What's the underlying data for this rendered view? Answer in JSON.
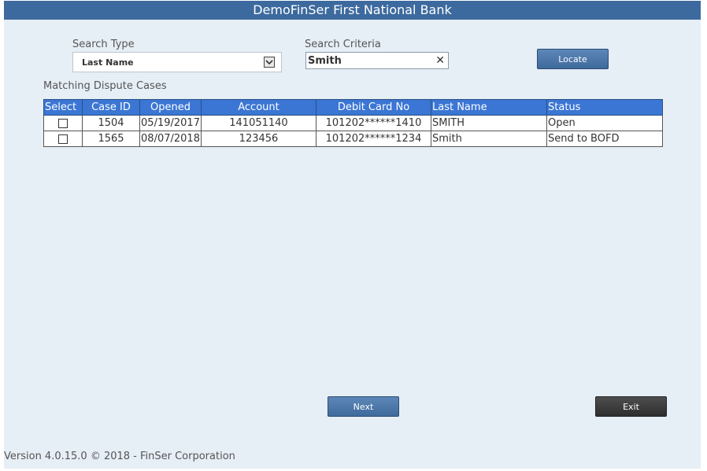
{
  "app": {
    "title": "DemoFinSer First National Bank"
  },
  "search": {
    "type_label": "Search Type",
    "type_value": "Last Name",
    "criteria_label": "Search Criteria",
    "criteria_value": "Smith",
    "clear_icon": "close-icon",
    "locate_label": "Locate"
  },
  "results": {
    "title": "Matching Dispute Cases",
    "headers": [
      "Select",
      "Case ID",
      "Opened",
      "Account",
      "Debit Card No",
      "Last Name",
      "Status"
    ],
    "rows": [
      [
        "",
        "1504",
        "05/19/2017",
        "141051140",
        "101202******1410",
        "SMITH",
        "Open"
      ],
      [
        "",
        "1565",
        "08/07/2018",
        "123456",
        "101202******1234",
        "Smith",
        "Send to BOFD"
      ]
    ]
  },
  "buttons": {
    "next": "Next",
    "exit": "Exit"
  },
  "footer": {
    "version": "Version 4.0.15.0 © 2018 - FinSer Corporation"
  },
  "colors": {
    "header_bar": "#3d6a9e",
    "table_header": "#3b76d4",
    "background": "#e6eef6"
  }
}
